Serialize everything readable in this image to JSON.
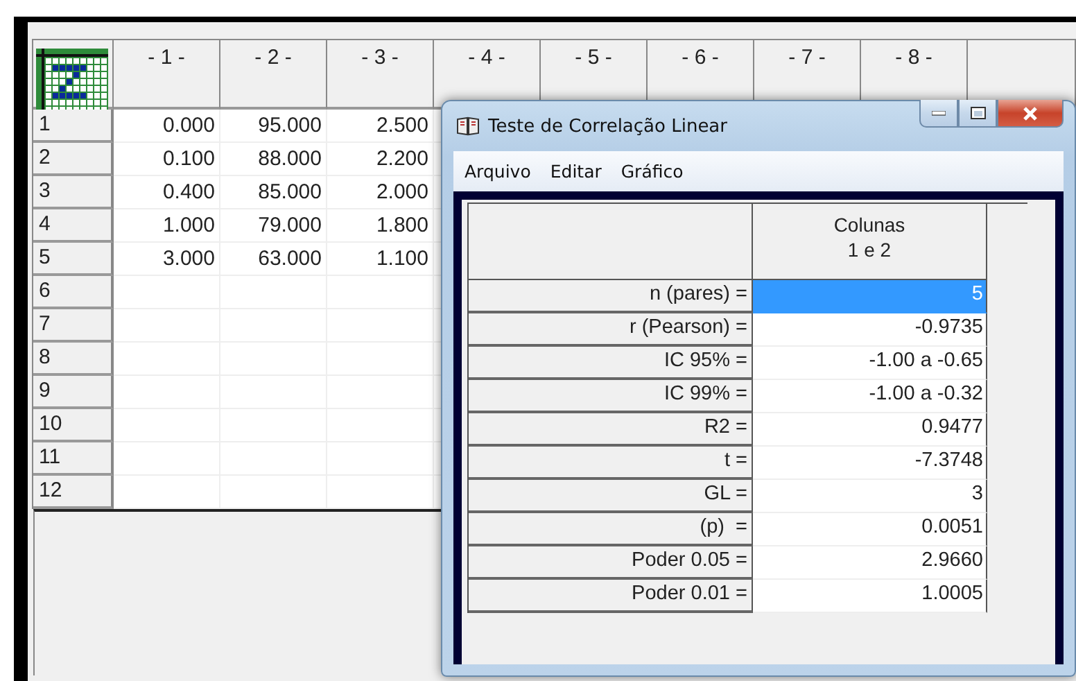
{
  "grid": {
    "columns": [
      "- 1 -",
      "- 2 -",
      "- 3 -",
      "- 4 -",
      "- 5 -",
      "- 6 -",
      "- 7 -",
      "- 8 -"
    ],
    "rows": [
      {
        "label": "1",
        "cells": [
          "0.000",
          "95.000",
          "2.500"
        ]
      },
      {
        "label": "2",
        "cells": [
          "0.100",
          "88.000",
          "2.200"
        ]
      },
      {
        "label": "3",
        "cells": [
          "0.400",
          "85.000",
          "2.000"
        ]
      },
      {
        "label": "4",
        "cells": [
          "1.000",
          "79.000",
          "1.800"
        ]
      },
      {
        "label": "5",
        "cells": [
          "3.000",
          "63.000",
          "1.100"
        ]
      },
      {
        "label": "6"
      },
      {
        "label": "7"
      },
      {
        "label": "8"
      },
      {
        "label": "9"
      },
      {
        "label": "10"
      },
      {
        "label": "11"
      },
      {
        "label": "12"
      }
    ]
  },
  "dialog": {
    "title": "Teste de Correlação Linear",
    "menu": [
      "Arquivo",
      "Editar",
      "Gráfico"
    ],
    "header_lines": [
      "Colunas",
      "1 e 2"
    ],
    "rows": [
      {
        "label": "n (pares) =",
        "value": "5",
        "selected": true
      },
      {
        "label": "r (Pearson) =",
        "value": "-0.9735",
        "selected": false
      },
      {
        "label": "IC 95% =",
        "value": "-1.00 a -0.65",
        "selected": false
      },
      {
        "label": "IC 99% =",
        "value": "-1.00 a -0.32",
        "selected": false
      },
      {
        "label": "R2 =",
        "value": "0.9477",
        "selected": false
      },
      {
        "label": "t =",
        "value": "-7.3748",
        "selected": false
      },
      {
        "label": "GL =",
        "value": "3",
        "selected": false
      },
      {
        "label": "(p)  =",
        "value": "0.0051",
        "selected": false
      },
      {
        "label": "Poder 0.05 =",
        "value": "2.9660",
        "selected": false
      },
      {
        "label": "Poder 0.01 =",
        "value": "1.0005",
        "selected": false
      }
    ]
  }
}
